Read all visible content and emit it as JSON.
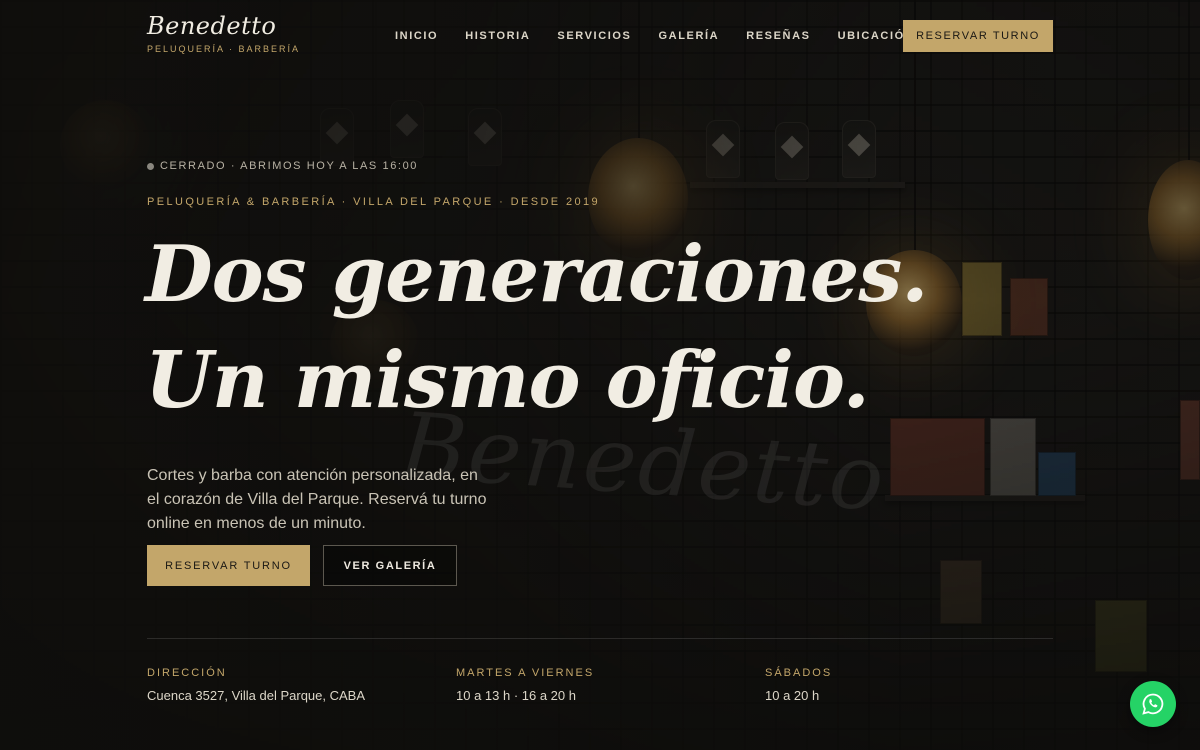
{
  "brand": {
    "name": "Benedetto",
    "tagline": "PELUQUERÍA · BARBERÍA",
    "watermark": "Benedetto"
  },
  "nav": {
    "items": [
      "INICIO",
      "HISTORIA",
      "SERVICIOS",
      "GALERÍA",
      "RESEÑAS",
      "UBICACIÓN"
    ],
    "cta_label": "RESERVAR TURNO"
  },
  "hero": {
    "status": "CERRADO · ABRIMOS HOY A LAS 16:00",
    "eyebrow": "PELUQUERÍA & BARBERÍA · VILLA DEL PARQUE · DESDE 2019",
    "headline_line1": "Dos generaciones.",
    "headline_line2": "Un mismo oficio.",
    "lead": "Cortes y barba con atención personalizada, en el corazón de Villa del Parque. Reservá tu turno online en menos de un minuto.",
    "primary_button": "RESERVAR TURNO",
    "secondary_button": "VER GALERÍA"
  },
  "info": [
    {
      "label": "DIRECCIÓN",
      "value": "Cuenca 3527, Villa del Parque, CABA"
    },
    {
      "label": "MARTES A VIERNES",
      "value": "10 a 13 h · 16 a 20 h"
    },
    {
      "label": "SÁBADOS",
      "value": "10 a 20 h"
    }
  ],
  "colors": {
    "accent": "#c3a66a",
    "background": "#121110",
    "whatsapp": "#25d366"
  },
  "icons": {
    "whatsapp": "whatsapp-icon",
    "status": "status-dot-icon"
  }
}
